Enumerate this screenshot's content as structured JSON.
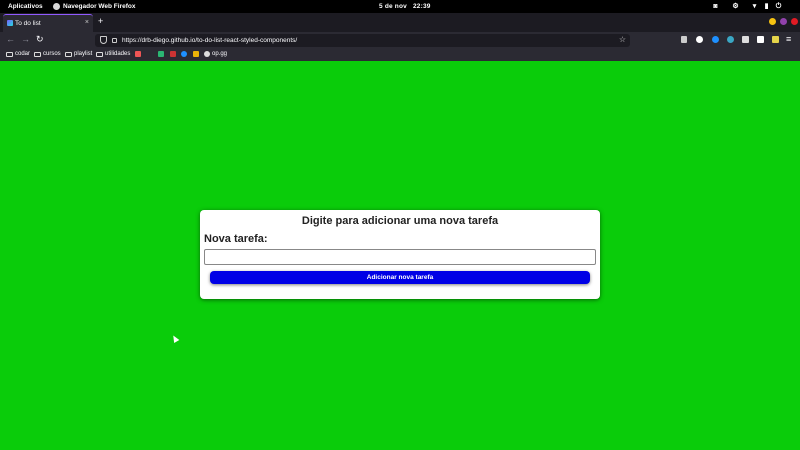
{
  "system_bar": {
    "activities": "Aplicativos",
    "app_name": "Navegador Web Firefox",
    "date": "5 de nov",
    "time": "22:39"
  },
  "browser": {
    "tab_title": "To do list",
    "tab_close": "×",
    "new_tab": "+",
    "url": "https://drb-diego.github.io/to-do-list-react-styled-components/",
    "back": "←",
    "forward": "→",
    "reload": "↻",
    "bookmark_star": "☆",
    "menu": "≡",
    "bookmarks": [
      {
        "label": "codar",
        "type": "folder"
      },
      {
        "label": "cursos",
        "type": "folder"
      },
      {
        "label": "playlist",
        "type": "folder"
      },
      {
        "label": "utilidades",
        "type": "folder"
      },
      {
        "label": "op.gg",
        "type": "link"
      }
    ]
  },
  "app": {
    "heading": "Digite para adicionar uma nova tarefa",
    "field_label": "Nova tarefa:",
    "input_value": "",
    "input_placeholder": "",
    "submit_label": "Adicionar nova tarefa"
  },
  "colors": {
    "page_background": "#0acc0a",
    "button_background": "#0000e6",
    "card_background": "#ffffff"
  }
}
